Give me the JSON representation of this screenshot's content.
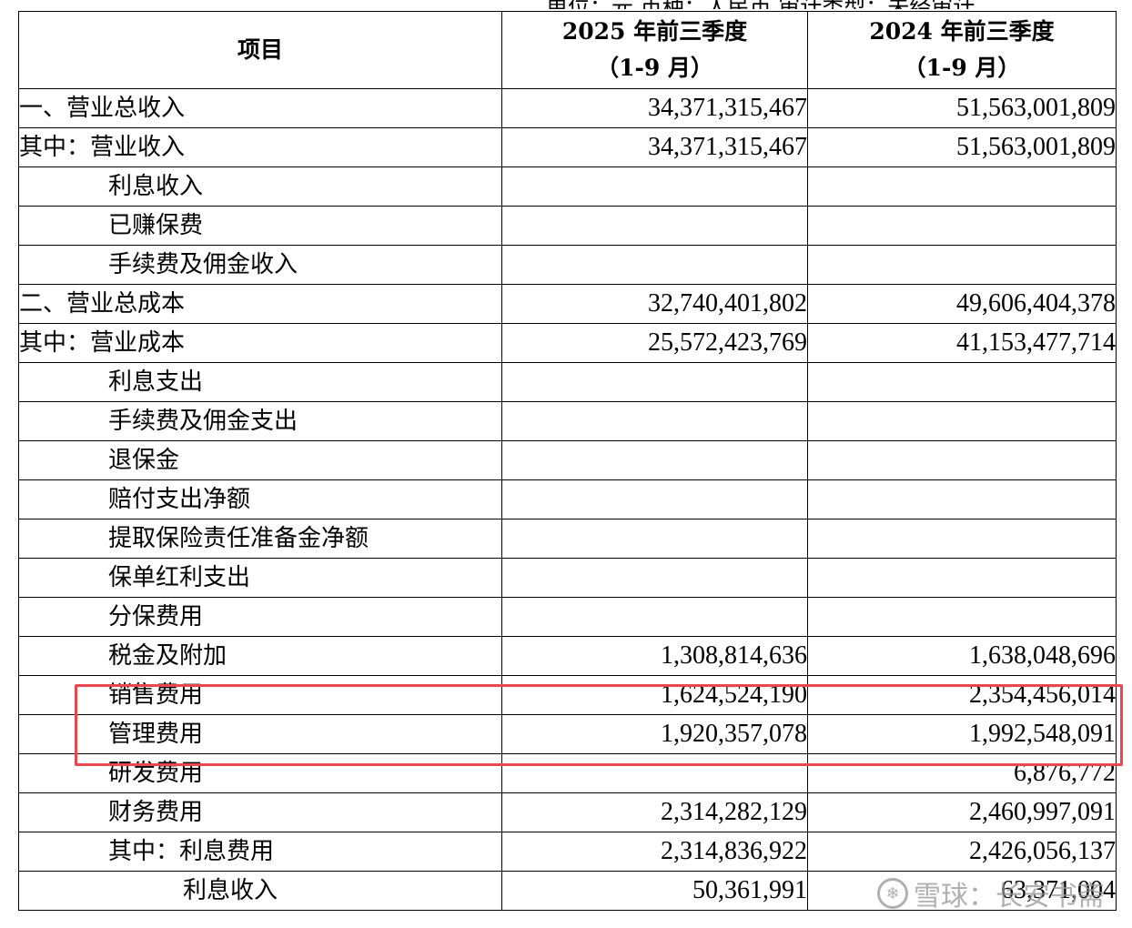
{
  "header": {
    "col_item": "项目",
    "col_2025_line1": "2025 年前三季度",
    "col_2025_line2": "（1-9 月）",
    "col_2024_line1": "2024 年前三季度",
    "col_2024_line2": "（1-9 月）",
    "top_fragment": "单位：元  币种：人民币  审计类型：未经审计"
  },
  "rows": [
    {
      "label": "一、营业总收入",
      "v2025": "34,371,315,467",
      "v2024": "51,563,001,809"
    },
    {
      "label": "其中：营业收入",
      "v2025": "34,371,315,467",
      "v2024": "51,563,001,809"
    },
    {
      "label": "利息收入",
      "v2025": "",
      "v2024": ""
    },
    {
      "label": "已赚保费",
      "v2025": "",
      "v2024": ""
    },
    {
      "label": "手续费及佣金收入",
      "v2025": "",
      "v2024": ""
    },
    {
      "label": "二、营业总成本",
      "v2025": "32,740,401,802",
      "v2024": "49,606,404,378"
    },
    {
      "label": "其中：营业成本",
      "v2025": "25,572,423,769",
      "v2024": "41,153,477,714"
    },
    {
      "label": "利息支出",
      "v2025": "",
      "v2024": ""
    },
    {
      "label": "手续费及佣金支出",
      "v2025": "",
      "v2024": ""
    },
    {
      "label": "退保金",
      "v2025": "",
      "v2024": ""
    },
    {
      "label": "赔付支出净额",
      "v2025": "",
      "v2024": ""
    },
    {
      "label": "提取保险责任准备金净额",
      "v2025": "",
      "v2024": ""
    },
    {
      "label": "保单红利支出",
      "v2025": "",
      "v2024": ""
    },
    {
      "label": "分保费用",
      "v2025": "",
      "v2024": ""
    },
    {
      "label": "税金及附加",
      "v2025": "1,308,814,636",
      "v2024": "1,638,048,696"
    },
    {
      "label": "销售费用",
      "v2025": "1,624,524,190",
      "v2024": "2,354,456,014"
    },
    {
      "label": "管理费用",
      "v2025": "1,920,357,078",
      "v2024": "1,992,548,091"
    },
    {
      "label": "研发费用",
      "v2025": "",
      "v2024": "6,876,772"
    },
    {
      "label": "财务费用",
      "v2025": "2,314,282,129",
      "v2024": "2,460,997,091"
    },
    {
      "label": "其中：利息费用",
      "v2025": "2,314,836,922",
      "v2024": "2,426,056,137"
    },
    {
      "label": "利息收入",
      "v2025": "50,361,991",
      "v2024": "63,371,004"
    }
  ],
  "highlight_color": "#e8474d",
  "watermark": {
    "text": "雪球：长安书斋",
    "icon": "snowball-logo-icon"
  }
}
